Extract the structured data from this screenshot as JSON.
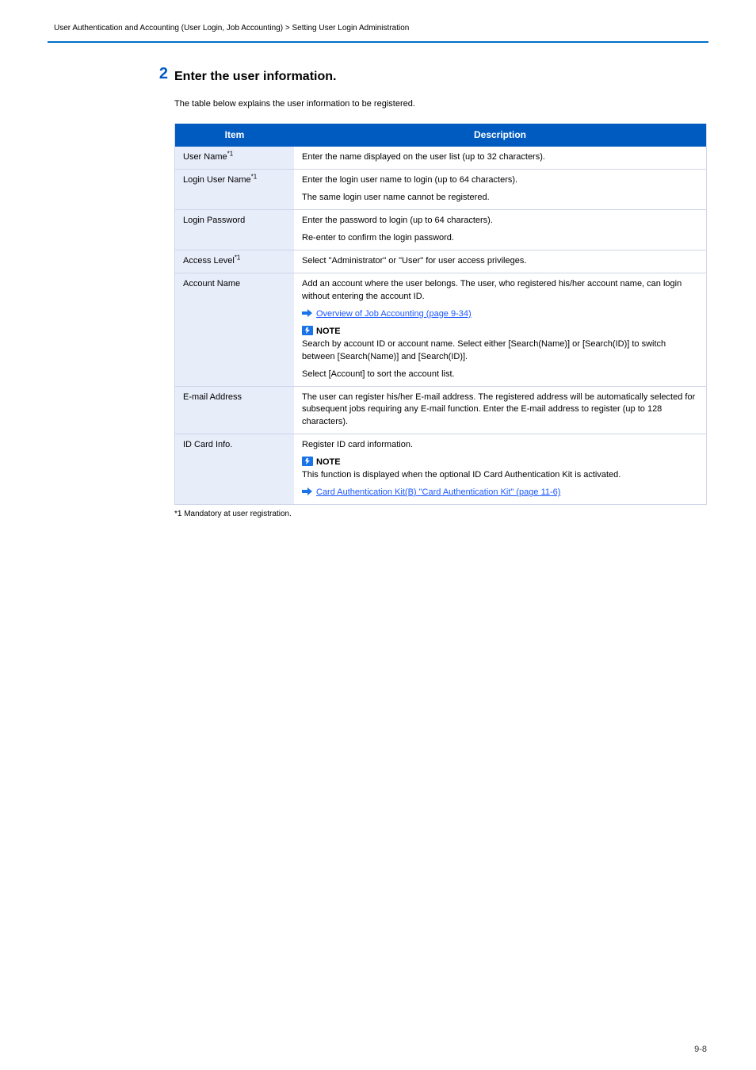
{
  "breadcrumb": "User Authentication and Accounting (User Login, Job Accounting) > Setting User Login Administration",
  "step_number": "2",
  "step_heading": "Enter the user information.",
  "intro": "The table below explains the user information to be registered.",
  "table": {
    "headers": [
      "Item",
      "Description"
    ],
    "rows": [
      {
        "item": "User Name",
        "item_star": "*1",
        "desc": "Enter the name displayed on the user list (up to 32 characters)."
      },
      {
        "item": "Login User Name",
        "item_star": "*1",
        "desc_line1": "Enter the login user name to login (up to 64 characters).",
        "desc_line2": "The same login user name cannot be registered."
      },
      {
        "item": "Login Password",
        "desc_line1": "Enter the password to login (up to 64 characters).",
        "desc_line2": "Re-enter to confirm the login password."
      },
      {
        "item": "Access Level",
        "item_star": "*1",
        "desc": "Select \"Administrator\" or \"User\" for user access privileges."
      },
      {
        "item": "Account Name",
        "desc_pre_link": "Add an account where the user belongs. The user, who registered his/her account name, can login without entering the account ID.",
        "link": "Overview of Job Accounting (page 9-34)",
        "note_label": "NOTE",
        "note_body": "Search by account ID or account name. Select either [Search(Name)] or [Search(ID)] to switch between [Search(Name)] and [Search(ID)].",
        "note_body2": "Select [Account] to sort the account list."
      },
      {
        "item": "E-mail Address",
        "desc": "The user can register his/her E-mail address. The registered address will be automatically selected for subsequent jobs requiring any E-mail function. Enter the E-mail address to register (up to 128 characters)."
      },
      {
        "item": "ID Card Info.",
        "desc": "Register ID card information.",
        "note_label": "NOTE",
        "note_body": "This function is displayed when the optional ID Card Authentication Kit is activated.",
        "link": "Card Authentication Kit(B) \"Card Authentication Kit\" (page 11-6)"
      }
    ],
    "footnote": "*1  Mandatory at user registration."
  },
  "page_num": "9-8"
}
